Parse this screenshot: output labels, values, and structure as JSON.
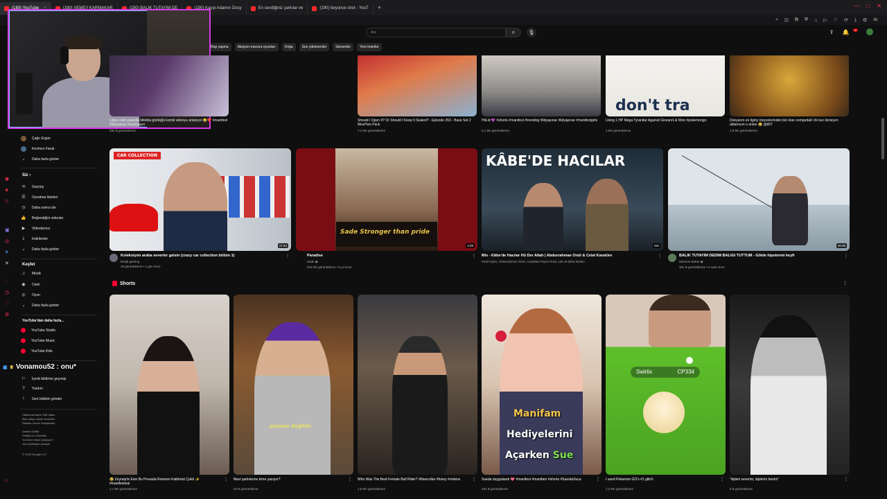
{
  "browser": {
    "tabs": [
      {
        "label": "(180) YouTube",
        "active": true
      },
      {
        "label": "(190) VEMEY KARMAKAR"
      },
      {
        "label": "(190) BALIK TUTAYIM DE"
      },
      {
        "label": "(190) Kayıp Adamın Dosy"
      },
      {
        "label": "En sevdiğiniz şarkılar ve"
      },
      {
        "label": "(190) beyonce shot - YouT"
      }
    ],
    "ai_label": "AI"
  },
  "header": {
    "search_placeholder": "Ara",
    "notif_count": "9+"
  },
  "chips": [
    "Rap yapma",
    "Aksiyon-macera oyunları",
    "Doğa",
    "Son yüklenenler",
    "İzlenenler",
    "Yeni öneriler"
  ],
  "sidebar": {
    "subs": [
      {
        "label": "Çağrı Ergün",
        "color": "#7a5a3a"
      },
      {
        "label": "Kerimce Faruk",
        "color": "#4a6a8a"
      },
      {
        "label": "Daha fazla göster",
        "icon": "⌄"
      }
    ],
    "you_head": "Siz",
    "you_items": [
      {
        "label": "Geçmiş",
        "icon": "⟲"
      },
      {
        "label": "Oynatma listeleri",
        "icon": "☰"
      },
      {
        "label": "Daha sonra izle",
        "icon": "◷"
      },
      {
        "label": "Beğendiğim videolar",
        "icon": "👍"
      },
      {
        "label": "Videolarınız",
        "icon": "▶"
      },
      {
        "label": "İndirilenler",
        "icon": "⤓"
      },
      {
        "label": "Daha fazla göster",
        "icon": "⌄"
      }
    ],
    "explore_head": "Keşfet",
    "explore_items": [
      {
        "label": "Müzik",
        "icon": "♫"
      },
      {
        "label": "Canlı",
        "icon": "◉"
      },
      {
        "label": "Oyun",
        "icon": "◎"
      },
      {
        "label": "Daha fazla göster",
        "icon": "⌄"
      }
    ],
    "more_head": "YouTube'dan daha fazla...",
    "more_items": [
      {
        "label": "YouTube Studio"
      },
      {
        "label": "YouTube Music"
      },
      {
        "label": "YouTube Kids"
      }
    ],
    "misc_items": [
      {
        "label": "İçerik bildirme geçmişi",
        "icon": "⚐"
      },
      {
        "label": "Yardım",
        "icon": "?"
      },
      {
        "label": "Geri bildirim gönder",
        "icon": "!"
      }
    ],
    "footer1": "Hakkında  Basın  Telif hakkı",
    "footer2": "Bize ulaşın  İçerik Üreticiler",
    "footer3": "Reklam verme  Geliştiriciler",
    "footer4": "Şartlar  Gizlilik",
    "footer5": "Politika ve Güvenlik",
    "footer6": "YouTube Nasıl Çalışıyor?",
    "footer7": "Yeni özellikleri deneyin",
    "copyright": "© 2025 Google LLC"
  },
  "chat": {
    "text": "Vonamou52 : onu*"
  },
  "top_row": [
    {
      "title": "Lidya canlı yayında tiktokta gördüğü komik videoyu anlatıyor 😂❤️ #manifest #lidyapınar #canlıyayın",
      "meta": "482 B görüntüleme"
    },
    {
      "title": "Should I Open It? Or Should I Keep It Sealed? - Episode 353 - Base Set 2 MewTwo Pack",
      "meta": "7,4 Mn görüntüleme"
    },
    {
      "title": "HilLid 💜 #shorts #manifest #trending #lidyapınar #lidyapınar #manifestgirls",
      "meta": "5,1 Mn görüntüleme"
    },
    {
      "title": "Using 1 HP Mega Tyranitar Against Giovanni & Won #pokemongo",
      "meta": "4 Mn görüntüleme"
    },
    {
      "title": "Dünyanın en ilginç meyvelerinden biri olan cempedak'ı ilk kez deneyen ablamızın o anları 😂 @it57",
      "meta": "1,9 Mn görüntüleme"
    }
  ],
  "videos": [
    {
      "title": "Koleksiyon araba severler gelsin (crazy car collection bölüm 1)",
      "channel": "berqk gaming",
      "stats": "29 görüntüleme • 1 gün önce",
      "duration": "17:44",
      "overlay": "CAR COLLECTION"
    },
    {
      "title": "Paradise",
      "channel": "Sade ◉",
      "stats": "210 Mn görüntüleme • 5 yıl önce",
      "duration": "4:09",
      "overlay": "Sade  Stronger than pride"
    },
    {
      "title": "Mix - Kâbe'de Hacılar Hû Der Allah | Abdurrahman Önül & Celal Karatüre",
      "channel": "Fadil Aydın, Abdurrahman Önül, Anatolian Psych Rock Lab ve daha fazlası",
      "stats": "",
      "duration": "Mix",
      "overlay": "KÂBE'DE HACILAR"
    },
    {
      "title": "BALIK TUTAYIM DEDİM BALIĞI TUTTUM - Gölde hipotermi keyfi",
      "channel": "Mertcan Bahar ◉",
      "stats": "351 B görüntüleme • 6 saat önce",
      "duration": "25:08",
      "overlay": ""
    }
  ],
  "shorts_label": "Shorts",
  "shorts": [
    {
      "title": "😂 Zeynep'le Esin Bu Provada Resmen Kalbimizi Çaldı ✨ #manifestival",
      "views": "1,7 Mn görüntüleme"
    },
    {
      "title": "Mavi şarkılarıne kime yazıyor?",
      "views": "62 B görüntüleme",
      "overlay": "pişman değilim"
    },
    {
      "title": "Who Was The Best Female Bull Rider? #bluecollar #funny #rodeos",
      "views": "1,8 Mn görüntüleme"
    },
    {
      "title": "Sueda duygulandı 💖 #manifest #manifam #shorts #SuedaUluca",
      "views": "491 B görüntüleme",
      "overlay1": "Manifam",
      "overlay2": "Hediyelerini",
      "overlay3": "Açarken",
      "overlay4": "Sue"
    },
    {
      "title": "I used Pokemon GO's #1 glitch",
      "views": "1,3 Mn görüntüleme",
      "poke_name": "Swirlix",
      "poke_cp": "CP334"
    },
    {
      "title": "\"dipleri severim, diplerim benim\"",
      "views": "8 B görüntüleme"
    }
  ],
  "colors": {
    "accent": "#ff0033",
    "webcam_border": "#d63ae8",
    "bg": "#0f0f0f"
  }
}
